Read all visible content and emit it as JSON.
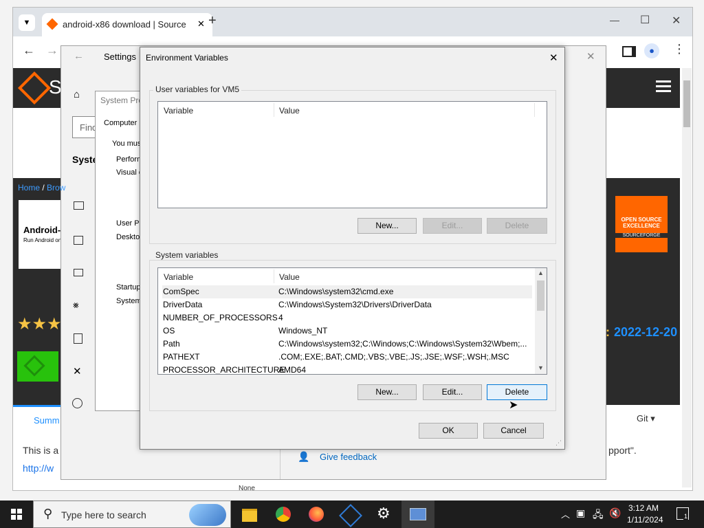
{
  "browser": {
    "tab_title": "android-x86 download | Source",
    "new_tab": "+",
    "min": "—",
    "max": "☐",
    "close": "✕"
  },
  "sourceforge": {
    "breadcrumb_home": "Home",
    "breadcrumb_sep": " / ",
    "breadcrumb_browse": "Brow",
    "project_name": "Android-x",
    "project_sub": "Run Android on",
    "badge_line1": "OPEN SOURCE",
    "badge_line2": "EXCELLENCE",
    "badge_brand": "SOURCEFORGE",
    "date_prefix": ":",
    "date": "2022-12-20",
    "tab_summary": "Summ",
    "git_label": "Git ▾",
    "body_text": "This is a",
    "body_link": "http://w",
    "port_text": "pport\".",
    "feedback": "Give feedback",
    "none_label": "None"
  },
  "settings": {
    "title": "Settings",
    "find_placeholder": "Find",
    "system_label": "System",
    "close": "✕"
  },
  "sysprop": {
    "title": "System Pro",
    "tab": "Computer N",
    "must": "You mus",
    "perf": "Perform",
    "visual": "Visual e",
    "user_profiles": "User Pr",
    "desktop": "Desktop",
    "startup": "Startup",
    "system": "System"
  },
  "env": {
    "title": "Environment Variables",
    "close": "✕",
    "user_group": "User variables for VM5",
    "system_group": "System variables",
    "col_variable": "Variable",
    "col_value": "Value",
    "user_buttons": {
      "new": "New...",
      "edit": "Edit...",
      "delete": "Delete"
    },
    "system_buttons": {
      "new": "New...",
      "edit": "Edit...",
      "delete": "Delete"
    },
    "ok": "OK",
    "cancel": "Cancel",
    "system_rows": [
      {
        "name": "ComSpec",
        "value": "C:\\Windows\\system32\\cmd.exe"
      },
      {
        "name": "DriverData",
        "value": "C:\\Windows\\System32\\Drivers\\DriverData"
      },
      {
        "name": "NUMBER_OF_PROCESSORS",
        "value": "4"
      },
      {
        "name": "OS",
        "value": "Windows_NT"
      },
      {
        "name": "Path",
        "value": "C:\\Windows\\system32;C:\\Windows;C:\\Windows\\System32\\Wbem;..."
      },
      {
        "name": "PATHEXT",
        "value": ".COM;.EXE;.BAT;.CMD;.VBS;.VBE;.JS;.JSE;.WSF;.WSH;.MSC"
      },
      {
        "name": "PROCESSOR_ARCHITECTURE",
        "value": "AMD64"
      }
    ]
  },
  "taskbar": {
    "search_placeholder": "Type here to search",
    "time": "3:12 AM",
    "date": "1/11/2024",
    "notif_count": "1"
  },
  "colors": {
    "sf_orange": "#ff6600",
    "sf_dark": "#2b2b2b",
    "link_blue": "#1a73e8",
    "date_blue": "#1e90ff",
    "focus_blue": "#0078d7"
  }
}
